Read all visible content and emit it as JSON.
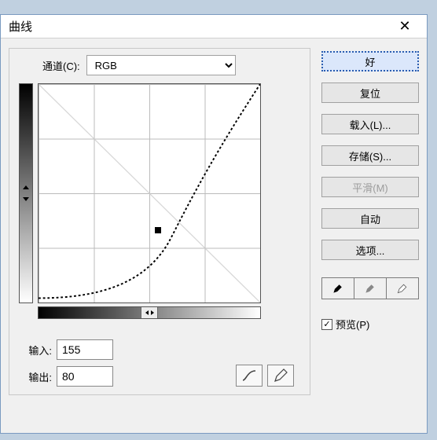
{
  "window": {
    "title": "曲线"
  },
  "channel": {
    "label": "通道(C):",
    "selected": "RGB"
  },
  "io": {
    "input_label": "输入:",
    "input_value": "155",
    "output_label": "输出:",
    "output_value": "80"
  },
  "buttons": {
    "ok": "好",
    "reset": "复位",
    "load": "载入(L)...",
    "save": "存储(S)...",
    "smooth": "平滑(M)",
    "auto": "自动",
    "options": "选项..."
  },
  "preview": {
    "label": "预览(P)",
    "checked": "✓"
  },
  "tools": {
    "curve": "curve-tool-icon",
    "pencil": "pencil-tool-icon"
  },
  "eyedroppers": {
    "black": "eyedropper-black-icon",
    "gray": "eyedropper-gray-icon",
    "white": "eyedropper-white-icon"
  },
  "chart_data": {
    "type": "line",
    "title": "曲线",
    "xlabel": "输入",
    "ylabel": "输出",
    "xlim": [
      0,
      255
    ],
    "ylim": [
      0,
      255
    ],
    "grid": true,
    "series": [
      {
        "name": "baseline",
        "x": [
          0,
          255
        ],
        "y": [
          0,
          255
        ]
      },
      {
        "name": "curve",
        "x": [
          0,
          32,
          64,
          96,
          128,
          155,
          192,
          224,
          255
        ],
        "y": [
          4,
          8,
          18,
          34,
          54,
          80,
          140,
          196,
          255
        ]
      }
    ],
    "control_points": [
      {
        "x": 155,
        "y": 80
      }
    ]
  }
}
